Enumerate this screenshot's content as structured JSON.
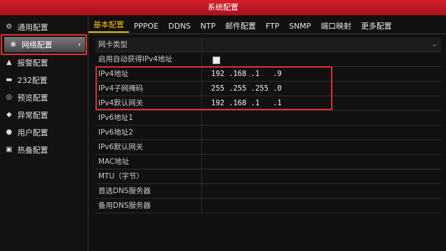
{
  "window": {
    "title": "系统配置"
  },
  "colors": {
    "accent": "#f2c200",
    "titlebar": "#c3161f",
    "highlight_box": "#e0342e"
  },
  "sidebar": {
    "items": [
      {
        "label": "通用配置",
        "icon": "gear-icon"
      },
      {
        "label": "网络配置",
        "icon": "network-icon",
        "active": true
      },
      {
        "label": "报警配置",
        "icon": "alarm-bell-icon"
      },
      {
        "label": "232配置",
        "icon": "serial-port-icon"
      },
      {
        "label": "预览配置",
        "icon": "eye-icon"
      },
      {
        "label": "异常配置",
        "icon": "warning-icon"
      },
      {
        "label": "用户配置",
        "icon": "users-icon"
      },
      {
        "label": "热备配置",
        "icon": "backup-icon"
      }
    ]
  },
  "tabs": [
    "基本配置",
    "PPPOE",
    "DDNS",
    "NTP",
    "邮件配置",
    "FTP",
    "SNMP",
    "端口映射",
    "更多配置"
  ],
  "form": {
    "rows": [
      {
        "label": "网卡类型",
        "value": ""
      },
      {
        "label": "启用自动获得IPv4地址",
        "value": ""
      },
      {
        "label": "IPv4地址",
        "value": "192 .168 .1   .9"
      },
      {
        "label": "IPv4子网掩码",
        "value": "255 .255 .255 .0"
      },
      {
        "label": "IPv4默认网关",
        "value": "192 .168 .1   .1"
      },
      {
        "label": "IPv6地址1",
        "value": ""
      },
      {
        "label": "IPv6地址2",
        "value": ""
      },
      {
        "label": "IPv6默认网关",
        "value": ""
      },
      {
        "label": "MAC地址",
        "value": ""
      },
      {
        "label": "MTU（字节）",
        "value": ""
      },
      {
        "label": "首选DNS服务器",
        "value": ""
      },
      {
        "label": "备用DNS服务器",
        "value": ""
      }
    ]
  }
}
